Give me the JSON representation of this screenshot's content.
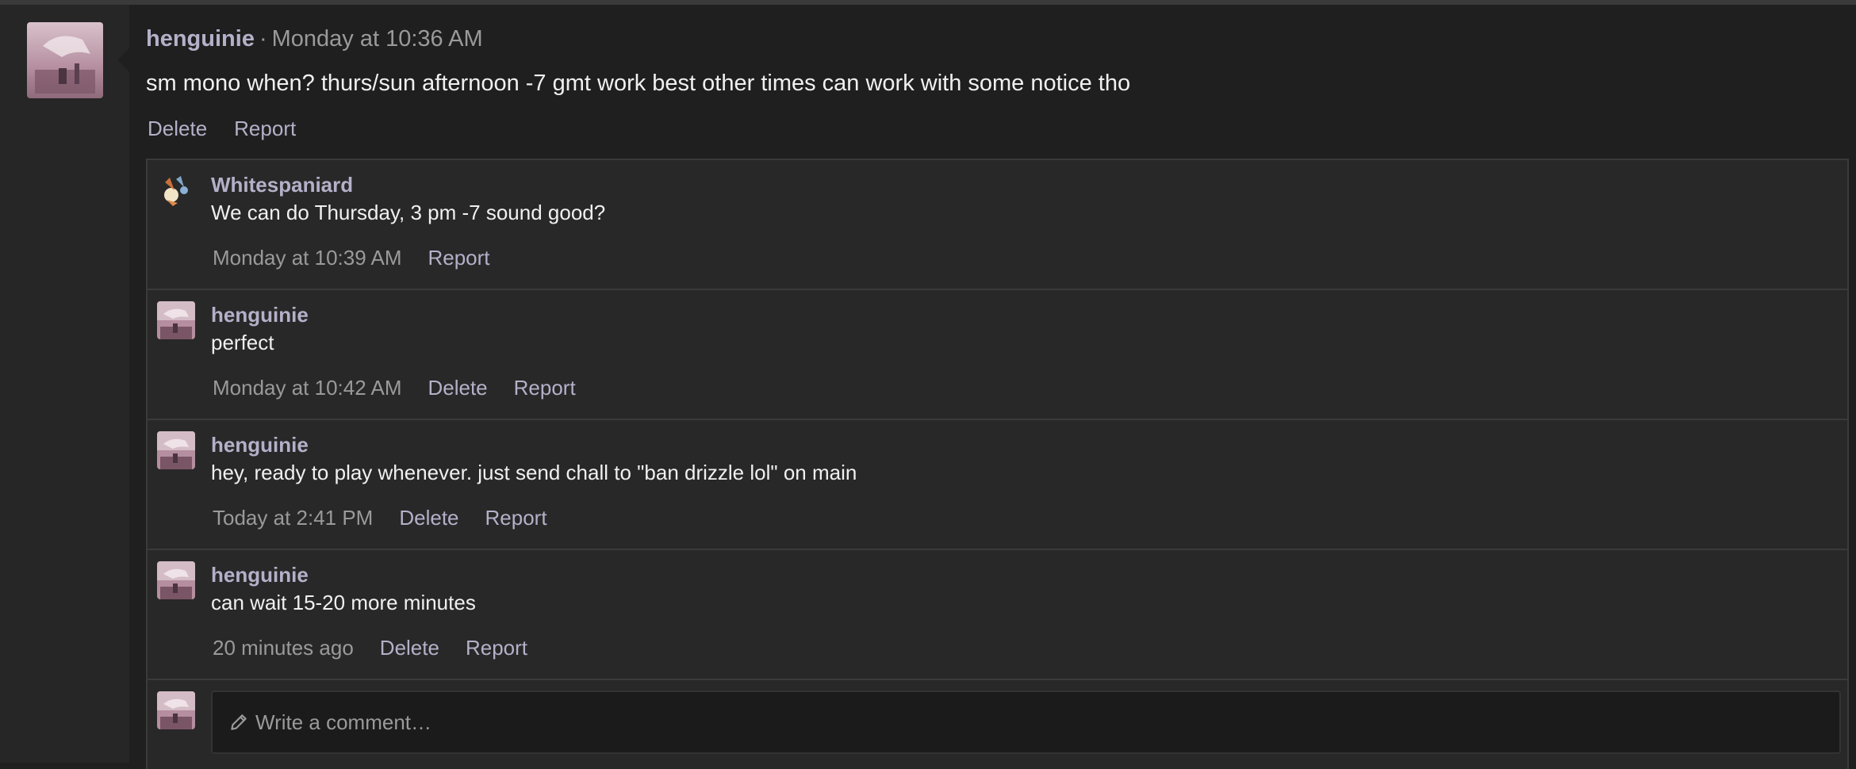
{
  "post": {
    "author": "henguinie",
    "separator": "·",
    "time": "Monday at 10:36 AM",
    "body": "sm mono when? thurs/sun afternoon -7 gmt work best other times can work with some notice tho",
    "delete_label": "Delete",
    "report_label": "Report"
  },
  "comments": [
    {
      "author": "Whitespaniard",
      "text": "We can do Thursday, 3 pm -7 sound good?",
      "time": "Monday at 10:39 AM",
      "report_label": "Report"
    },
    {
      "author": "henguinie",
      "text": "perfect",
      "time": "Monday at 10:42 AM",
      "delete_label": "Delete",
      "report_label": "Report"
    },
    {
      "author": "henguinie",
      "text": "hey, ready to play whenever. just send chall to \"ban drizzle lol\" on main",
      "time": "Today at 2:41 PM",
      "delete_label": "Delete",
      "report_label": "Report"
    },
    {
      "author": "henguinie",
      "text": "can wait 15-20 more minutes",
      "time": "20 minutes ago",
      "delete_label": "Delete",
      "report_label": "Report"
    }
  ],
  "composer": {
    "placeholder": "Write a comment…",
    "icon": "pencil-icon"
  },
  "colors": {
    "link": "#b5b0c9",
    "background": "#1f1f1f",
    "panel": "#282828"
  }
}
